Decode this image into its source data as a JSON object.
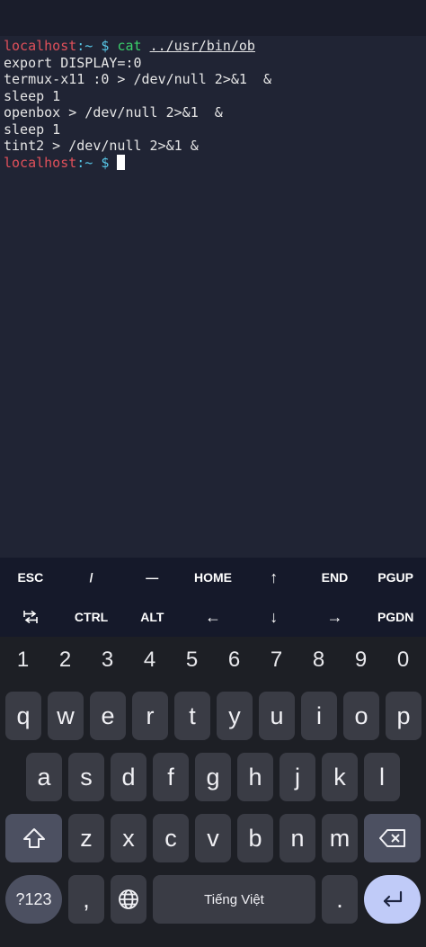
{
  "terminal": {
    "prompt_host": "localhost",
    "prompt_sep": ":~ $ ",
    "cmd1": "cat",
    "cmd1_path": "../usr/bin/ob",
    "output": [
      "export DISPLAY=:0",
      "termux-x11 :0 > /dev/null 2>&1  &",
      "sleep 1",
      "openbox > /dev/null 2>&1  &",
      "sleep 1",
      "tint2 > /dev/null 2>&1 &"
    ]
  },
  "extra_keys": {
    "row1": [
      "ESC",
      "/",
      "—",
      "HOME",
      "↑",
      "END",
      "PGUP"
    ],
    "row2": [
      "tab-icon",
      "CTRL",
      "ALT",
      "←",
      "↓",
      "→",
      "PGDN"
    ]
  },
  "keyboard": {
    "numbers": [
      "1",
      "2",
      "3",
      "4",
      "5",
      "6",
      "7",
      "8",
      "9",
      "0"
    ],
    "row_q": [
      "q",
      "w",
      "e",
      "r",
      "t",
      "y",
      "u",
      "i",
      "o",
      "p"
    ],
    "row_a": [
      "a",
      "s",
      "d",
      "f",
      "g",
      "h",
      "j",
      "k",
      "l"
    ],
    "row_z": [
      "z",
      "x",
      "c",
      "v",
      "b",
      "n",
      "m"
    ],
    "sym_label": "?123",
    "comma": ",",
    "space_label": "Tiếng Việt",
    "period": ".",
    "icons": {
      "shift": "shift-icon",
      "backspace": "backspace-icon",
      "globe": "globe-icon",
      "enter": "enter-icon"
    }
  },
  "colors": {
    "prompt_host": "#e0505a",
    "prompt_tilde": "#58c8e8",
    "command": "#3ad06a",
    "enter_key": "#c0cbf8"
  }
}
